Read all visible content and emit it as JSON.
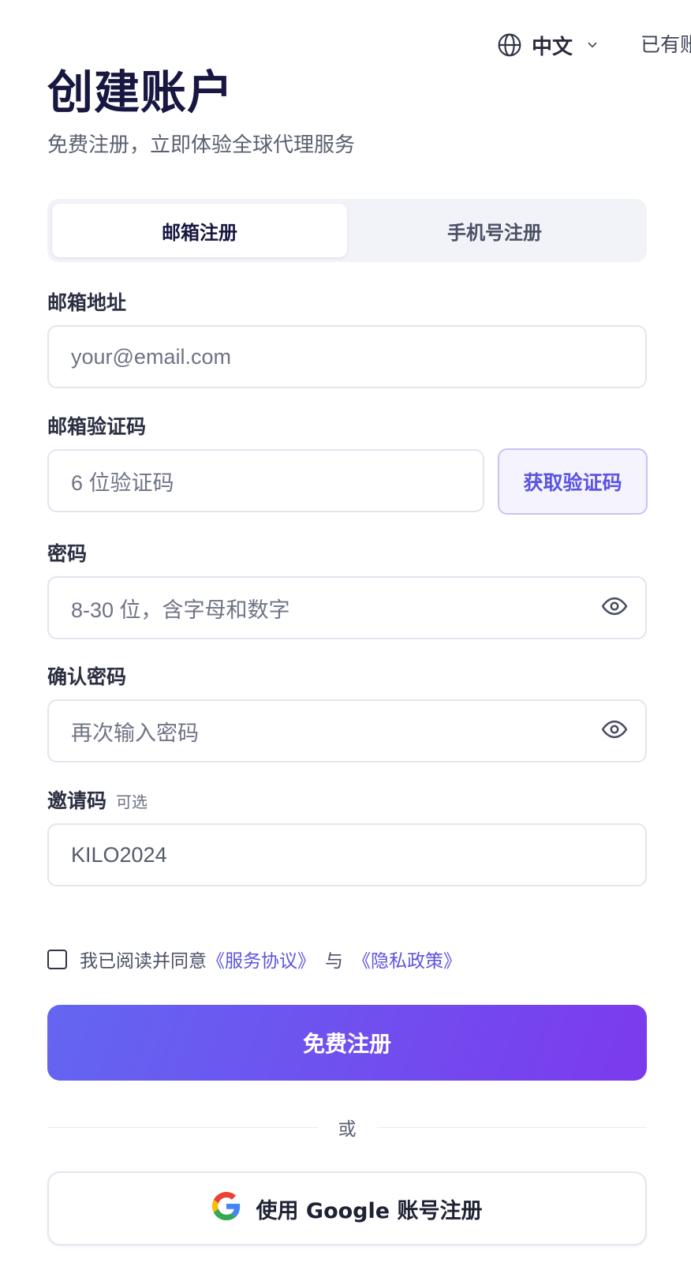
{
  "header": {
    "language": "中文",
    "login_hint": "已有账"
  },
  "title": "创建账户",
  "subtitle": "免费注册，立即体验全球代理服务",
  "tabs": [
    {
      "label": "邮箱注册",
      "active": true
    },
    {
      "label": "手机号注册",
      "active": false
    }
  ],
  "email": {
    "label": "邮箱地址",
    "placeholder": "your@email.com"
  },
  "code": {
    "label": "邮箱验证码",
    "placeholder": "6 位验证码",
    "button": "获取验证码"
  },
  "password": {
    "label": "密码",
    "placeholder": "8-30 位，含字母和数字"
  },
  "confirm": {
    "label": "确认密码",
    "placeholder": "再次输入密码"
  },
  "invite": {
    "label": "邀请码",
    "optional": "可选",
    "value": "KILO2024"
  },
  "agreement": {
    "prefix": "我已阅读并同意",
    "terms": "《服务协议》",
    "and": "与",
    "privacy": "《隐私政策》",
    "checked": false
  },
  "submit_label": "免费注册",
  "divider_text": "或",
  "google_label": "使用 Google 账号注册",
  "colors": {
    "accent": "#5b54e0",
    "gradient_start": "#6366f1",
    "gradient_end": "#7c3aed",
    "title": "#171741"
  },
  "icons": {
    "language": "globe-icon",
    "dropdown": "chevron-down-icon",
    "toggle_password": "eye-icon",
    "google": "google-logo-icon"
  }
}
